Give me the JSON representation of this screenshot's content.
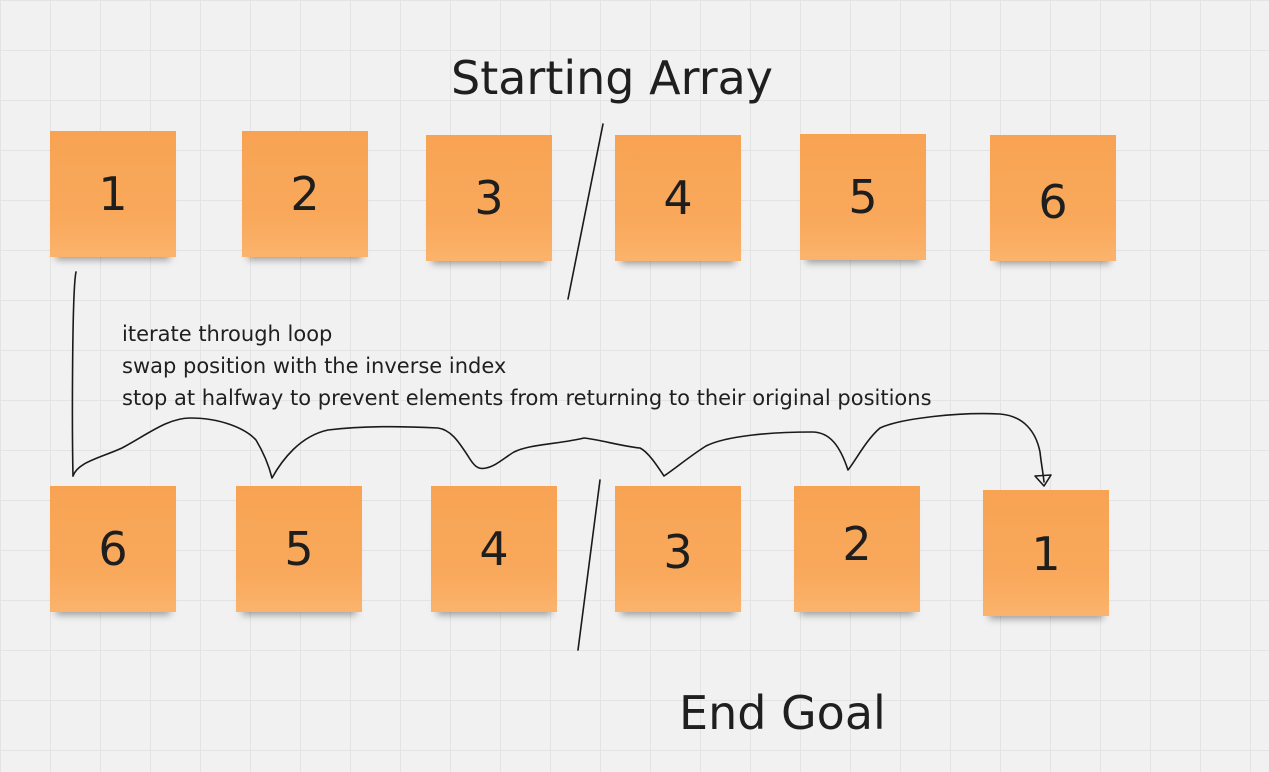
{
  "headings": {
    "start": "Starting Array",
    "end": "End Goal"
  },
  "starting_array": [
    "1",
    "2",
    "3",
    "4",
    "5",
    "6"
  ],
  "end_array": [
    "6",
    "5",
    "4",
    "3",
    "2",
    "1"
  ],
  "notes": [
    "iterate through loop",
    "swap position with the inverse index",
    "stop at halfway to prevent elements from returning to their original positions"
  ],
  "colors": {
    "sticky_note": "#f9a95c",
    "canvas": "#f1f1f1",
    "ink": "#1a1a1a"
  }
}
